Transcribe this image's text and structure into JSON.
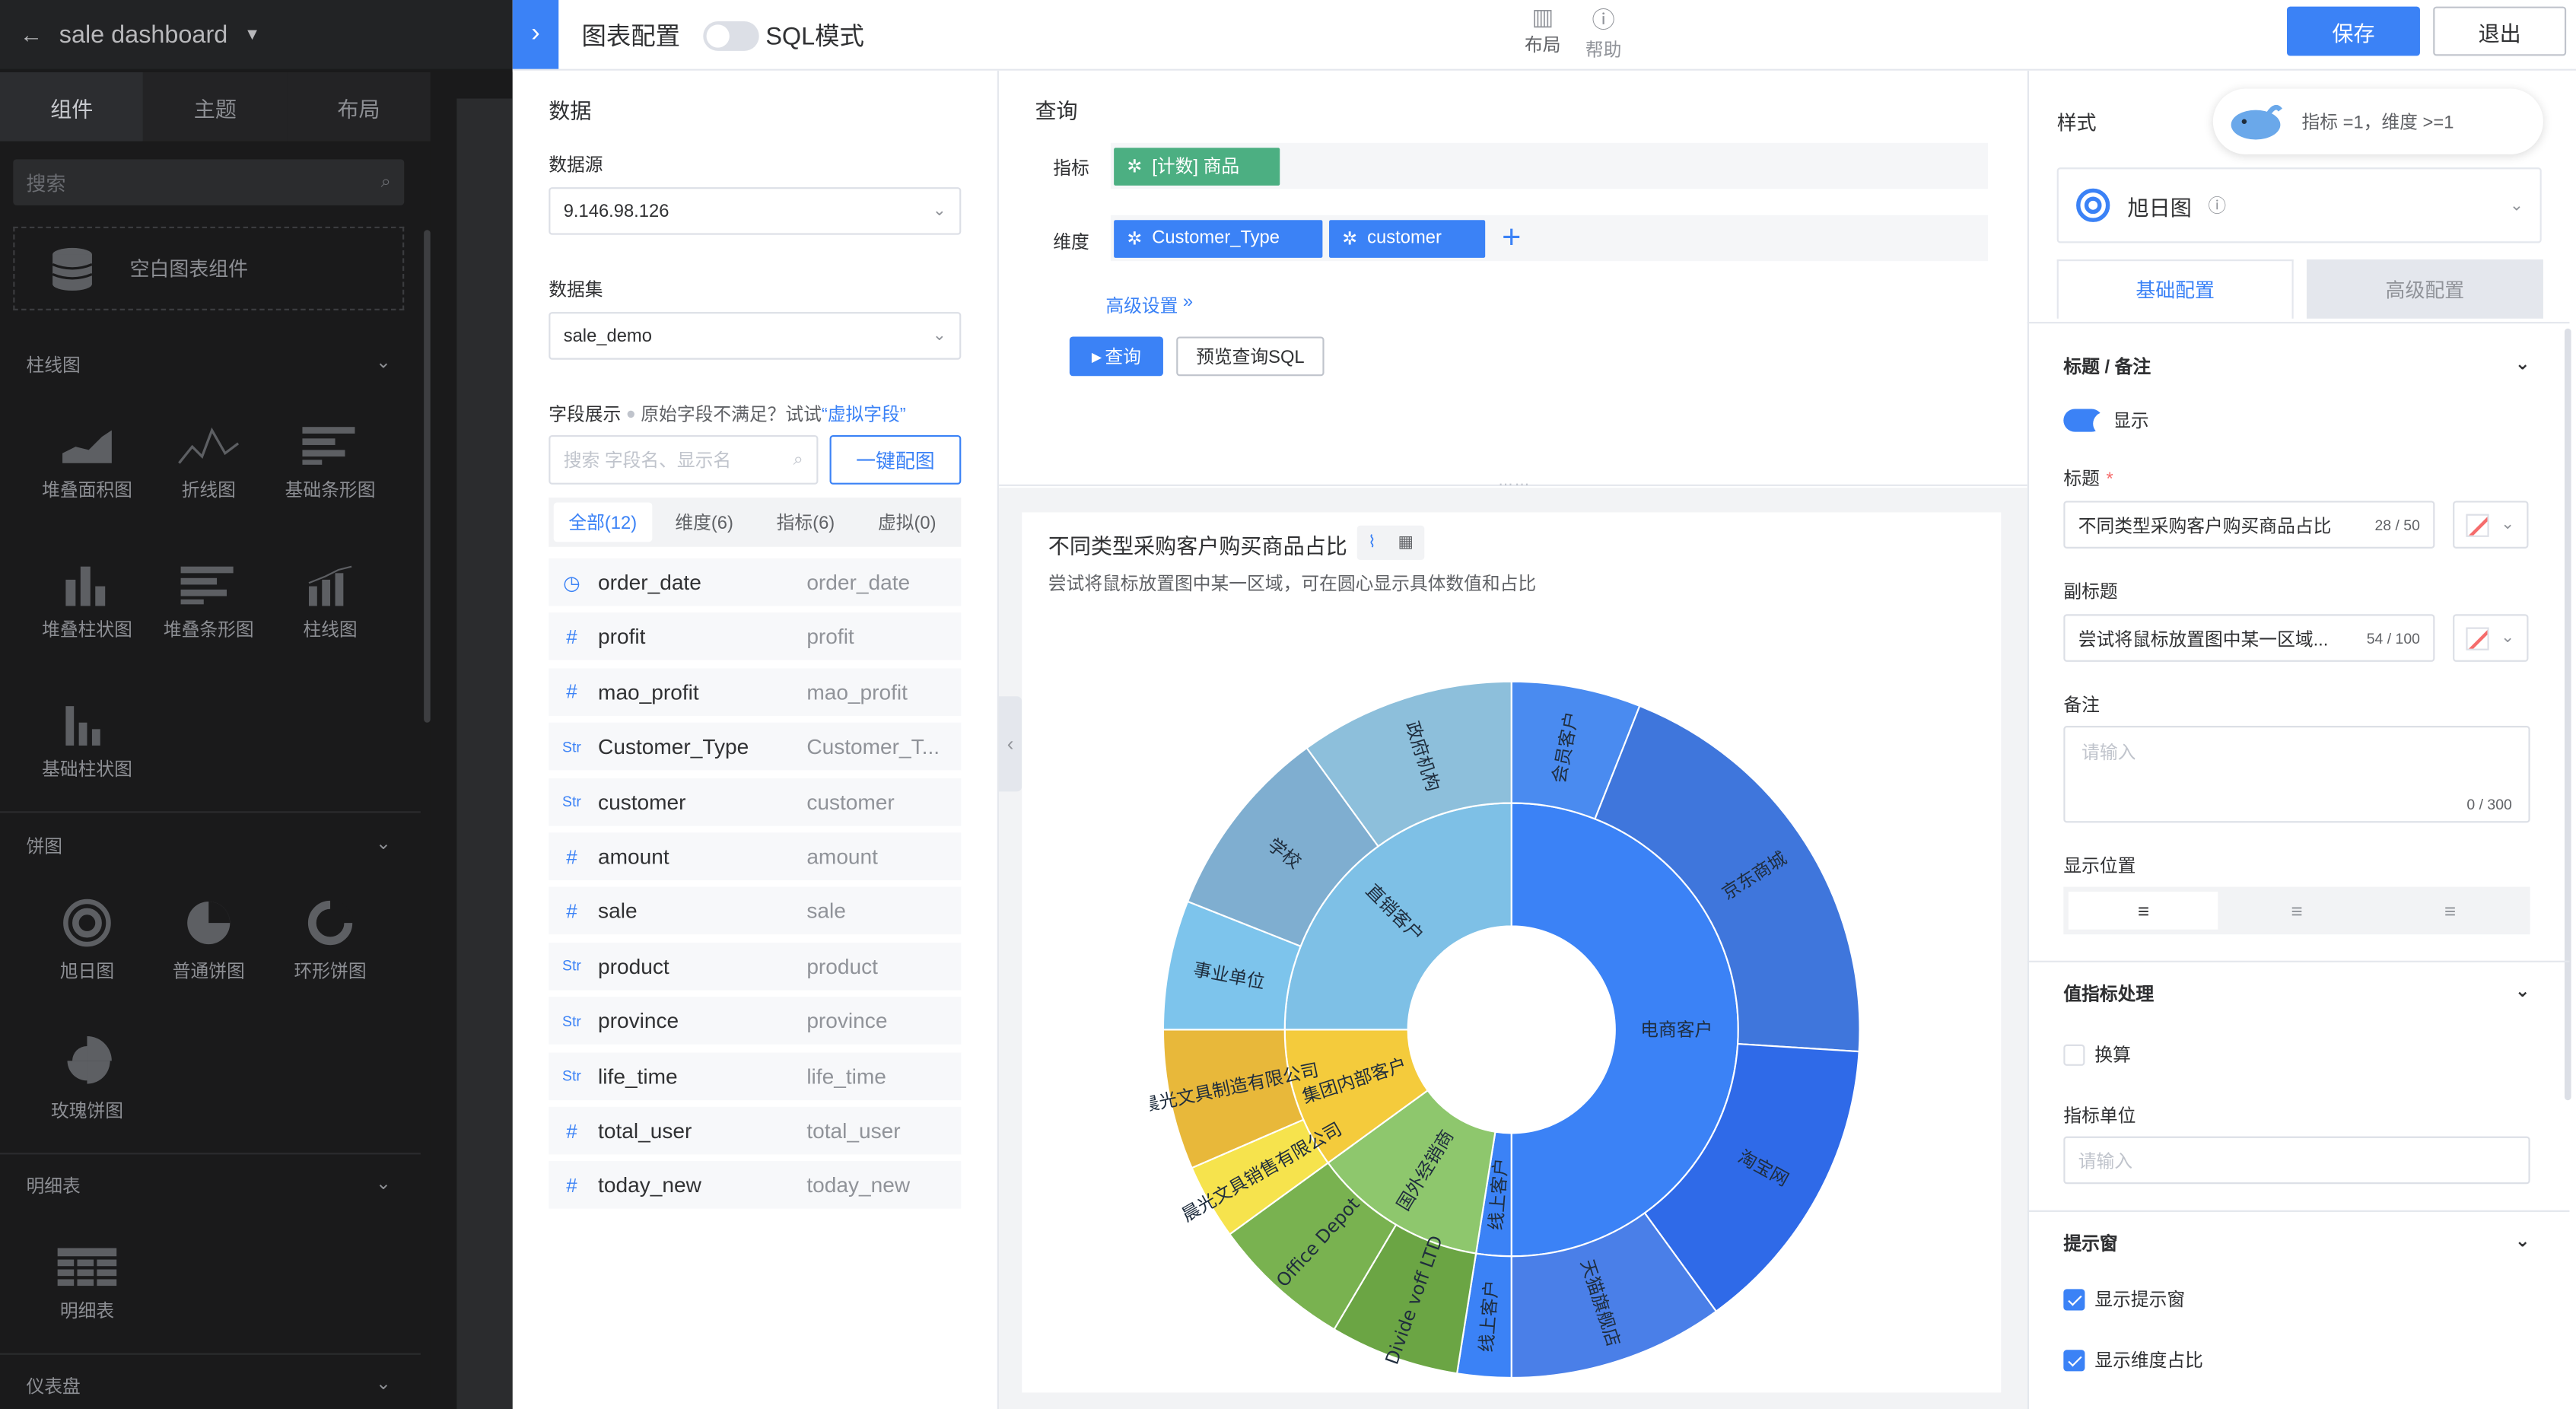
{
  "left_panel": {
    "dashboard_name": "sale dashboard",
    "tabs": [
      "组件",
      "主题",
      "布局"
    ],
    "search_placeholder": "搜索",
    "empty_component": "空白图表组件",
    "groups": [
      {
        "title": "柱线图",
        "items": [
          "堆叠面积图",
          "折线图",
          "基础条形图",
          "堆叠柱状图",
          "堆叠条形图",
          "柱线图",
          "基础柱状图"
        ]
      },
      {
        "title": "饼图",
        "items": [
          "旭日图",
          "普通饼图",
          "环形饼图",
          "玫瑰饼图"
        ]
      },
      {
        "title": "明细表",
        "items": [
          "明细表"
        ]
      },
      {
        "title": "仪表盘",
        "items": []
      }
    ]
  },
  "topbar": {
    "title": "图表配置",
    "sql_mode": "SQL模式",
    "layout": "布局",
    "help": "帮助",
    "save": "保存",
    "exit": "退出"
  },
  "data_panel": {
    "title": "数据",
    "datasource_label": "数据源",
    "datasource_value": "9.146.98.126",
    "dataset_label": "数据集",
    "dataset_value": "sale_demo",
    "fields_label": "字段展示",
    "fields_hint": "原始字段不满足？试试",
    "virtual_link": "“虚拟字段”",
    "field_search_placeholder": "搜索 字段名、显示名",
    "one_click": "一键配图",
    "filter_tabs": [
      "全部(12)",
      "维度(6)",
      "指标(6)",
      "虚拟(0)"
    ],
    "fields": [
      {
        "type": "time",
        "name": "order_date",
        "alias": "order_date"
      },
      {
        "type": "num",
        "name": "profit",
        "alias": "profit"
      },
      {
        "type": "num",
        "name": "mao_profit",
        "alias": "mao_profit"
      },
      {
        "type": "str",
        "name": "Customer_Type",
        "alias": "Customer_T..."
      },
      {
        "type": "str",
        "name": "customer",
        "alias": "customer"
      },
      {
        "type": "num",
        "name": "amount",
        "alias": "amount"
      },
      {
        "type": "num",
        "name": "sale",
        "alias": "sale"
      },
      {
        "type": "str",
        "name": "product",
        "alias": "product"
      },
      {
        "type": "str",
        "name": "province",
        "alias": "province"
      },
      {
        "type": "str",
        "name": "life_time",
        "alias": "life_time"
      },
      {
        "type": "num",
        "name": "total_user",
        "alias": "total_user"
      },
      {
        "type": "num",
        "name": "today_new",
        "alias": "today_new"
      }
    ]
  },
  "query_panel": {
    "title": "查询",
    "metric_label": "指标",
    "metric_pill": "[计数] 商品",
    "dimension_label": "维度",
    "dimension_pills": [
      "Customer_Type",
      "customer"
    ],
    "advanced": "高级设置",
    "query_button": "查询",
    "preview_sql": "预览查询SQL"
  },
  "chart_card": {
    "title": "不同类型采购客户购买商品占比",
    "subtitle": "尝试将鼠标放置图中某一区域，可在圆心显示具体数值和占比"
  },
  "chart_data": {
    "type": "sunburst",
    "inner": [
      {
        "name": "电商客户",
        "value": 50,
        "color": "#3b82f6"
      },
      {
        "name": "线上客户",
        "value": 2.5,
        "color": "#3b82f6"
      },
      {
        "name": "国外经销商",
        "value": 12.5,
        "color": "#8ec76d"
      },
      {
        "name": "集团内部客户",
        "value": 10,
        "color": "#f4cb3c"
      },
      {
        "name": "直销客户",
        "value": 25,
        "color": "#7ec0e6"
      }
    ],
    "outer": [
      {
        "name": "会员客户",
        "value": 6,
        "color": "#4a8bf0"
      },
      {
        "name": "京东商城",
        "value": 20,
        "color": "#3f76dc"
      },
      {
        "name": "淘宝网",
        "value": 14,
        "color": "#2f6ae8"
      },
      {
        "name": "天猫旗舰店",
        "value": 10,
        "color": "#4a7fe8"
      },
      {
        "name": "线上客户",
        "value": 2.5,
        "color": "#3b82f6"
      },
      {
        "name": "Divide voff LTD",
        "value": 6,
        "color": "#6ba544"
      },
      {
        "name": "Office Depot",
        "value": 6.5,
        "color": "#79b250"
      },
      {
        "name": "晨光文具销售有限公司",
        "value": 3.5,
        "color": "#f6e34d"
      },
      {
        "name": "晨光文具制造有限公司",
        "value": 6.5,
        "color": "#e8b83a"
      },
      {
        "name": "事业单位",
        "value": 6,
        "color": "#7dc4ec"
      },
      {
        "name": "学校",
        "value": 9,
        "color": "#7faed0"
      },
      {
        "name": "政府机构",
        "value": 10,
        "color": "#8dbfdb"
      }
    ]
  },
  "style_panel": {
    "title": "样式",
    "tip": "指标 =1，维度 >=1",
    "chart_type": "旭日图",
    "tabs": [
      "基础配置",
      "高级配置"
    ],
    "title_section": "标题 / 备注",
    "show": "显示",
    "title_label": "标题",
    "title_value": "不同类型采购客户购买商品占比",
    "title_count": "28 / 50",
    "subtitle_label": "副标题",
    "subtitle_value": "尝试将鼠标放置图中某一区域...",
    "subtitle_count": "54 / 100",
    "note_label": "备注",
    "note_placeholder": "请输入",
    "note_count": "0 / 300",
    "position_label": "显示位置",
    "value_section": "值指标处理",
    "convert": "换算",
    "unit_label": "指标单位",
    "unit_placeholder": "请输入",
    "tooltip_section": "提示窗",
    "show_tooltip": "显示提示窗",
    "show_dim_ratio": "显示维度占比"
  }
}
